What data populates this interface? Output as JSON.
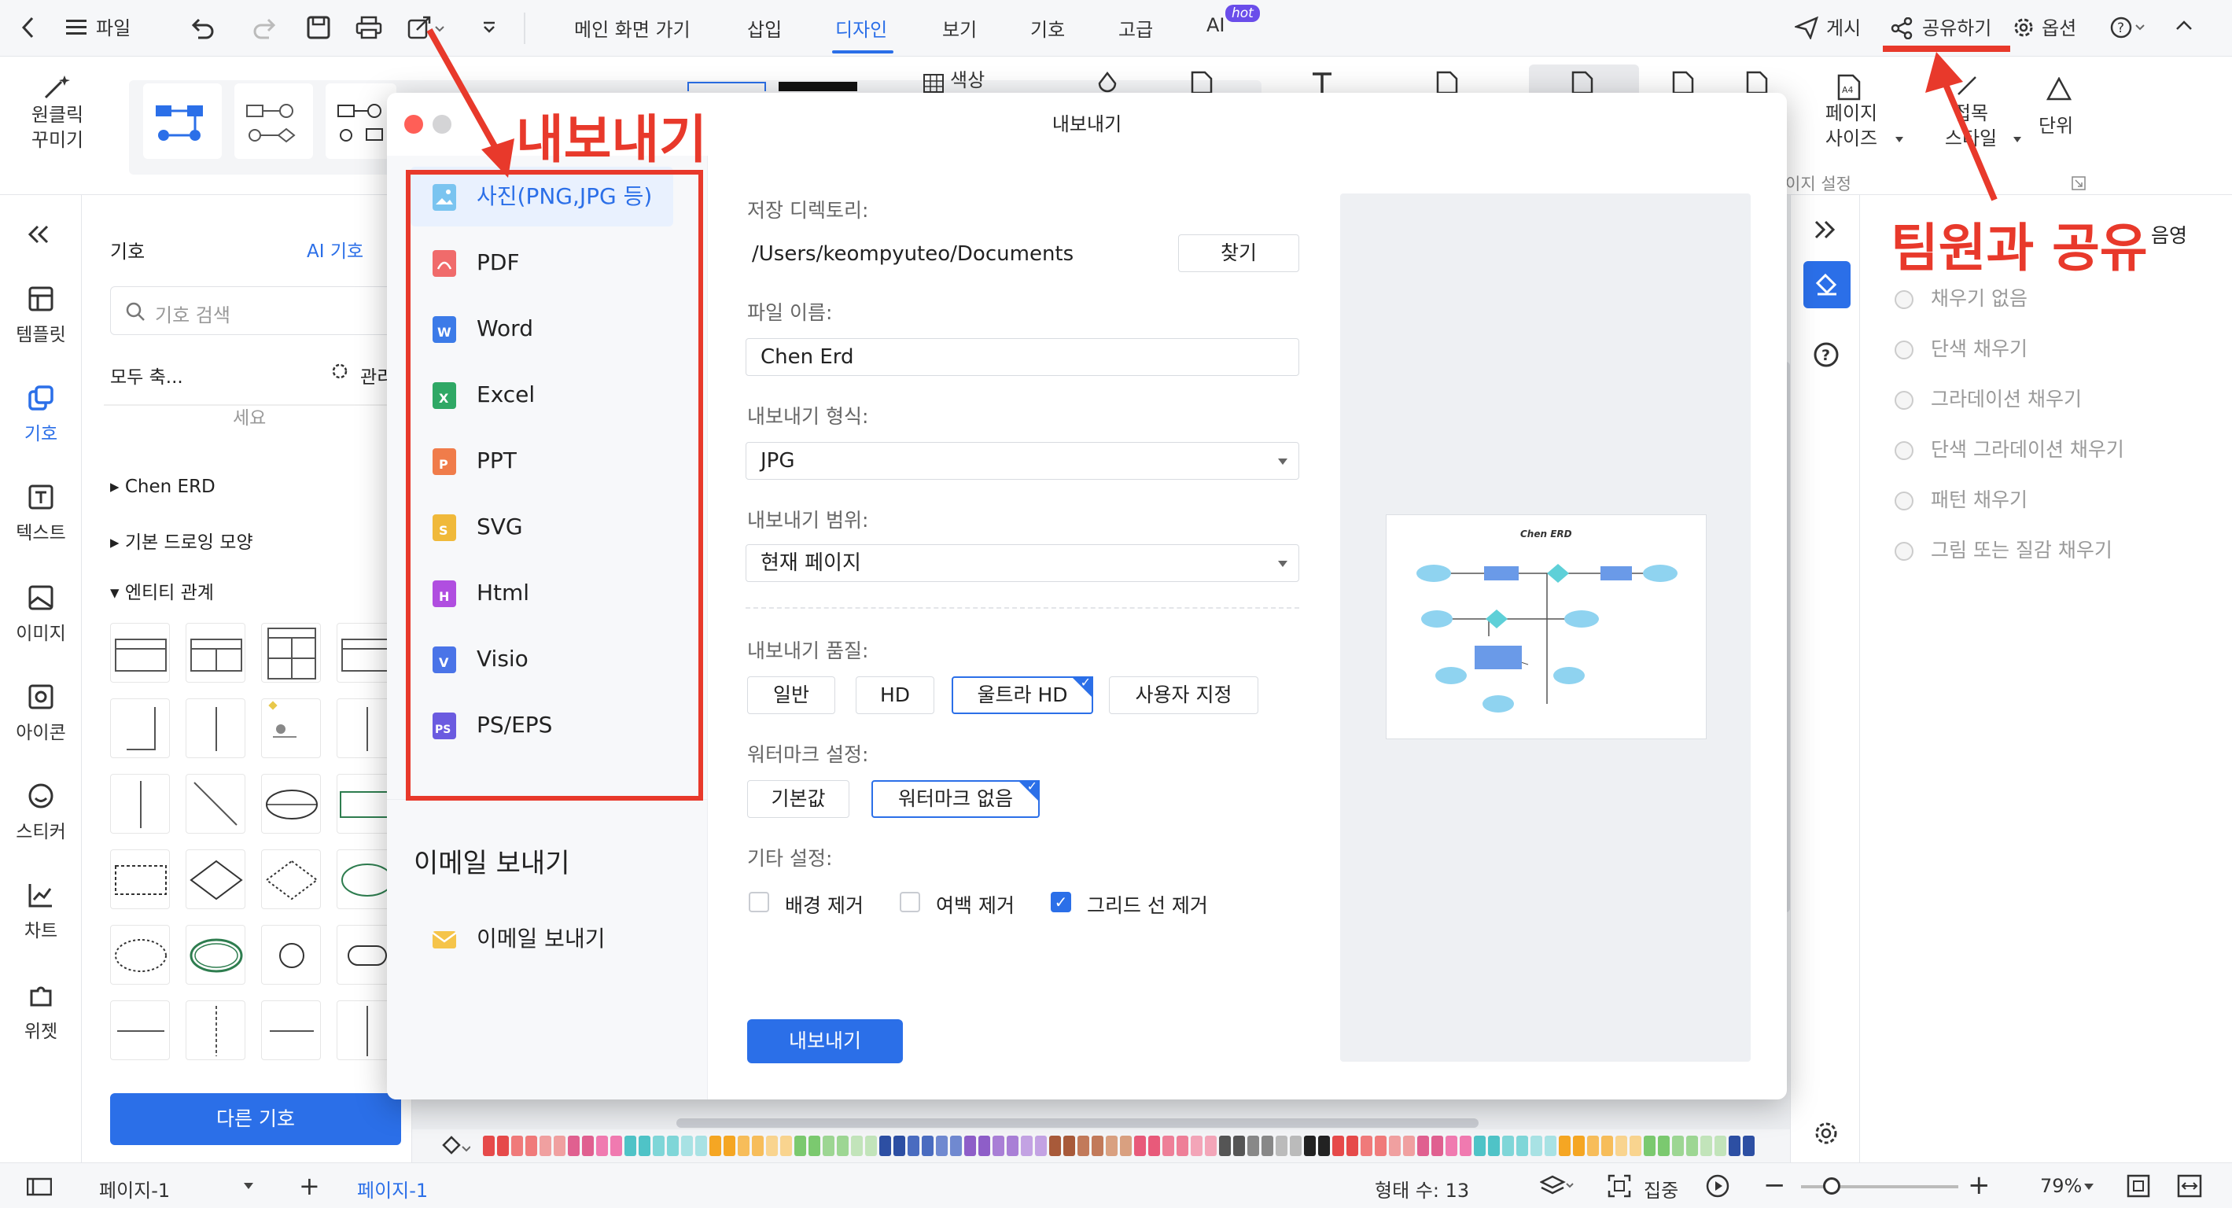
{
  "topbar": {
    "file": "파일",
    "menus": [
      "메인 화면 가기",
      "삽입",
      "디자인",
      "보기",
      "기호",
      "고급",
      "AI"
    ],
    "active_menu": "디자인",
    "hot": "hot",
    "right": [
      "게시",
      "공유하기",
      "옵션"
    ]
  },
  "ribbon": {
    "oneclick": "원클릭\n꾸미기",
    "color": "색상",
    "page_size": "페이지\n사이즈",
    "connector": "접목\n스타일",
    "unit": "단위",
    "section": "이지 설정"
  },
  "rail": [
    "템플릿",
    "기호",
    "텍스트",
    "이미지",
    "아이콘",
    "스티커",
    "차트",
    "위젯"
  ],
  "rail_active": "기호",
  "symbols": {
    "title": "기호",
    "ai": "AI 기호",
    "search_placeholder": "기호 검색",
    "collapse": "모두 축...",
    "manage": "관리",
    "partial": "세요",
    "groups": [
      "Chen ERD",
      "기본 드로잉 모양",
      "엔티티 관계"
    ],
    "more_button": "다른 기호"
  },
  "fill_panel": {
    "label": "음영",
    "options": [
      "채우기 없음",
      "단색 채우기",
      "그라데이션 채우기",
      "단색 그라데이션 채우기",
      "패턴 채우기",
      "그림 또는 질감 채우기"
    ]
  },
  "dialog": {
    "title": "내보내기",
    "formats": [
      "사진(PNG,JPG 등)",
      "PDF",
      "Word",
      "Excel",
      "PPT",
      "SVG",
      "Html",
      "Visio",
      "PS/EPS"
    ],
    "active_format": "사진(PNG,JPG 등)",
    "email_heading": "이메일 보내기",
    "email_item": "이메일 보내기",
    "dir_label": "저장 디렉토리:",
    "dir_value": "/Users/keompyuteo/Documents",
    "browse": "찾기",
    "filename_label": "파일 이름:",
    "filename_value": "Chen Erd",
    "format_label": "내보내기 형식:",
    "format_value": "JPG",
    "range_label": "내보내기 범위:",
    "range_value": "현재 페이지",
    "quality_label": "내보내기 품질:",
    "quality": [
      "일반",
      "HD",
      "울트라 HD",
      "사용자 지정"
    ],
    "quality_selected": "울트라 HD",
    "watermark_label": "워터마크 설정:",
    "watermark": [
      "기본값",
      "워터마크 없음"
    ],
    "watermark_selected": "워터마크 없음",
    "other_label": "기타 설정:",
    "options": [
      {
        "label": "배경 제거",
        "checked": false
      },
      {
        "label": "여백 제거",
        "checked": false
      },
      {
        "label": "그리드 선 제거",
        "checked": true
      }
    ],
    "export_button": "내보내기",
    "preview_title": "Chen ERD"
  },
  "status": {
    "page_select": "페이지-1",
    "page_tab": "페이지-1",
    "shape_count": "형태 수: 13",
    "focus": "집중",
    "zoom": "79%"
  },
  "annotations": {
    "export": "내보내기",
    "share": "팀원과 공유"
  },
  "colors": {
    "accent": "#2b6fe8",
    "annotation": "#e8392b",
    "preview_node": "#8fd3f0",
    "preview_box": "#6a9ae8"
  }
}
